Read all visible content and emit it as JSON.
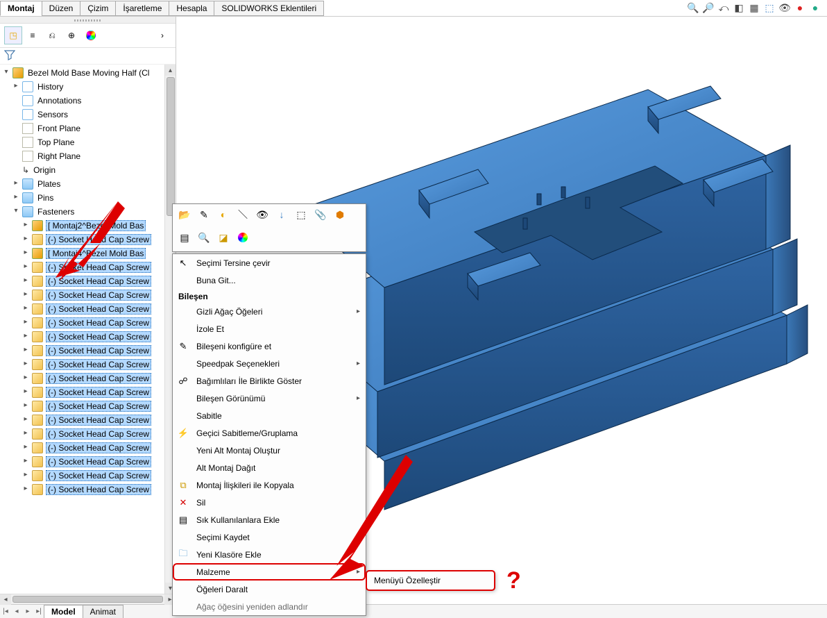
{
  "tabs": {
    "t0": "Montaj",
    "t1": "Düzen",
    "t2": "Çizim",
    "t3": "İşaretleme",
    "t4": "Hesapla",
    "t5": "SOLIDWORKS Eklentileri"
  },
  "feature_root": "Bezel Mold Base Moving Half  (Cl",
  "items": {
    "history": "History",
    "annotations": "Annotations",
    "sensors": "Sensors",
    "front": "Front Plane",
    "top": "Top Plane",
    "right": "Right Plane",
    "origin": "Origin",
    "plates": "Plates",
    "pins": "Pins",
    "fasteners": "Fasteners"
  },
  "fasteners_children": [
    "[ Montaj2^Bezel Mold Bas",
    "(-) Socket Head Cap Screw",
    "[ Montaj4^Bezel Mold Bas",
    "(-) Socket Head Cap Screw",
    "(-) Socket Head Cap Screw",
    "(-) Socket Head Cap Screw",
    "(-) Socket Head Cap Screw",
    "(-) Socket Head Cap Screw",
    "(-) Socket Head Cap Screw",
    "(-) Socket Head Cap Screw",
    "(-) Socket Head Cap Screw",
    "(-) Socket Head Cap Screw",
    "(-) Socket Head Cap Screw",
    "(-) Socket Head Cap Screw",
    "(-) Socket Head Cap Screw",
    "(-) Socket Head Cap Screw",
    "(-) Socket Head Cap Screw",
    "(-) Socket Head Cap Screw",
    "(-) Socket Head Cap Screw",
    "(-) Socket Head Cap Screw"
  ],
  "ctx": {
    "invert": "Seçimi Tersine çevir",
    "goto": "Buna Git...",
    "section": "Bileşen",
    "hidden": "Gizli Ağaç Öğeleri",
    "isolate": "İzole Et",
    "configure": "Bileşeni konfigüre et",
    "speedpak": "Speedpak Seçenekleri",
    "withdeps": "Bağımlıları İle Birlikte Göster",
    "compview": "Bileşen Görünümü",
    "fix": "Sabitle",
    "tempfix": "Geçici Sabitleme/Gruplama",
    "newsubasm": "Yeni Alt Montaj Oluştur",
    "dissolve": "Alt Montaj Dağıt",
    "copywithmates": "Montaj İlişkileri ile Kopyala",
    "delete": "Sil",
    "addfav": "Sık Kullanılanlara Ekle",
    "saveselection": "Seçimi Kaydet",
    "newfolder": "Yeni Klasöre Ekle",
    "material": "Malzeme",
    "collapse": "Öğeleri Daralt",
    "rename": "Ağaç öğesini yeniden adlandır"
  },
  "submenu": {
    "customize": "Menüyü Özelleştir"
  },
  "bottom": {
    "model": "Model",
    "anim": "Animat"
  },
  "annotation_q": "?"
}
